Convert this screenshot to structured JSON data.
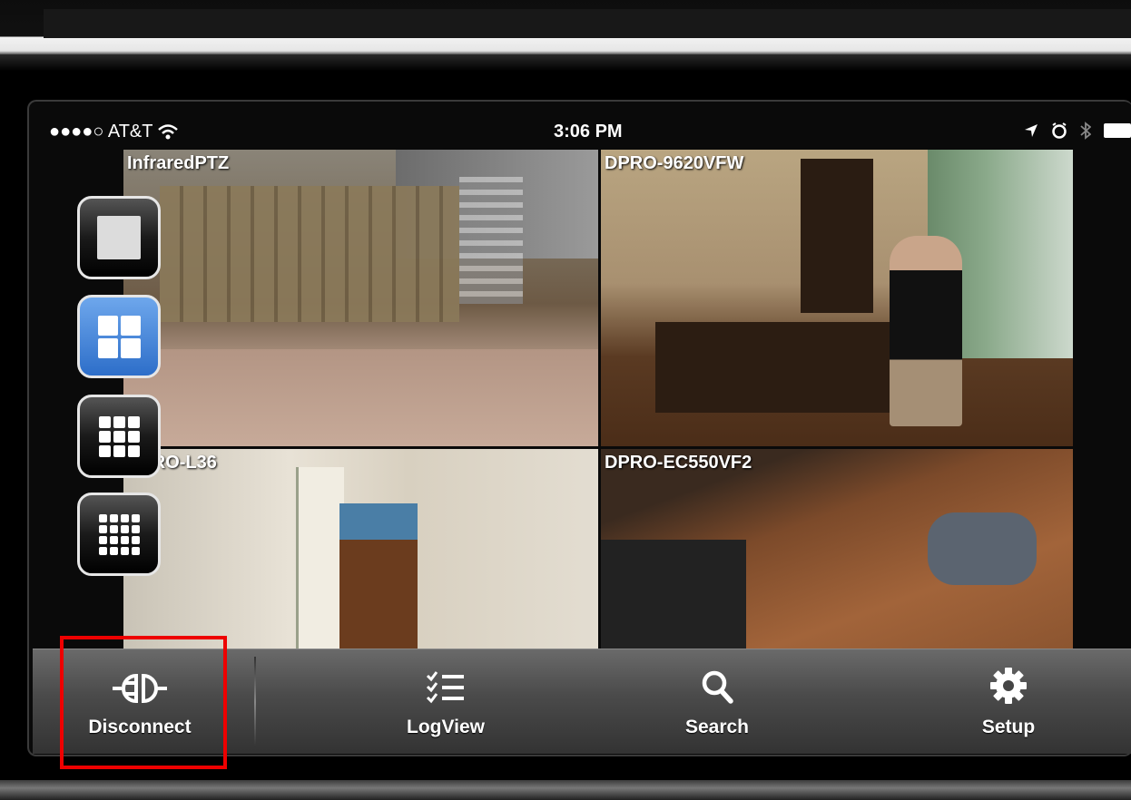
{
  "status_bar": {
    "carrier": "●●●●○ AT&T",
    "time": "3:06 PM"
  },
  "cameras": [
    {
      "label": "InfraredPTZ"
    },
    {
      "label": "DPRO-9620VFW"
    },
    {
      "label": "DPRO-L36"
    },
    {
      "label": "DPRO-EC550VF2"
    }
  ],
  "layout_options": [
    "single-view",
    "quad-view",
    "nine-view",
    "sixteen-view"
  ],
  "active_layout": "quad-view",
  "toolbar": {
    "items": [
      {
        "label": "Disconnect",
        "icon": "disconnect-plug-icon"
      },
      {
        "label": "LogView",
        "icon": "log-list-icon"
      },
      {
        "label": "Search",
        "icon": "search-icon"
      },
      {
        "label": "Setup",
        "icon": "gear-icon"
      }
    ]
  },
  "colors": {
    "highlight": "#ee0000",
    "active_layout": "#3a7bd5"
  }
}
